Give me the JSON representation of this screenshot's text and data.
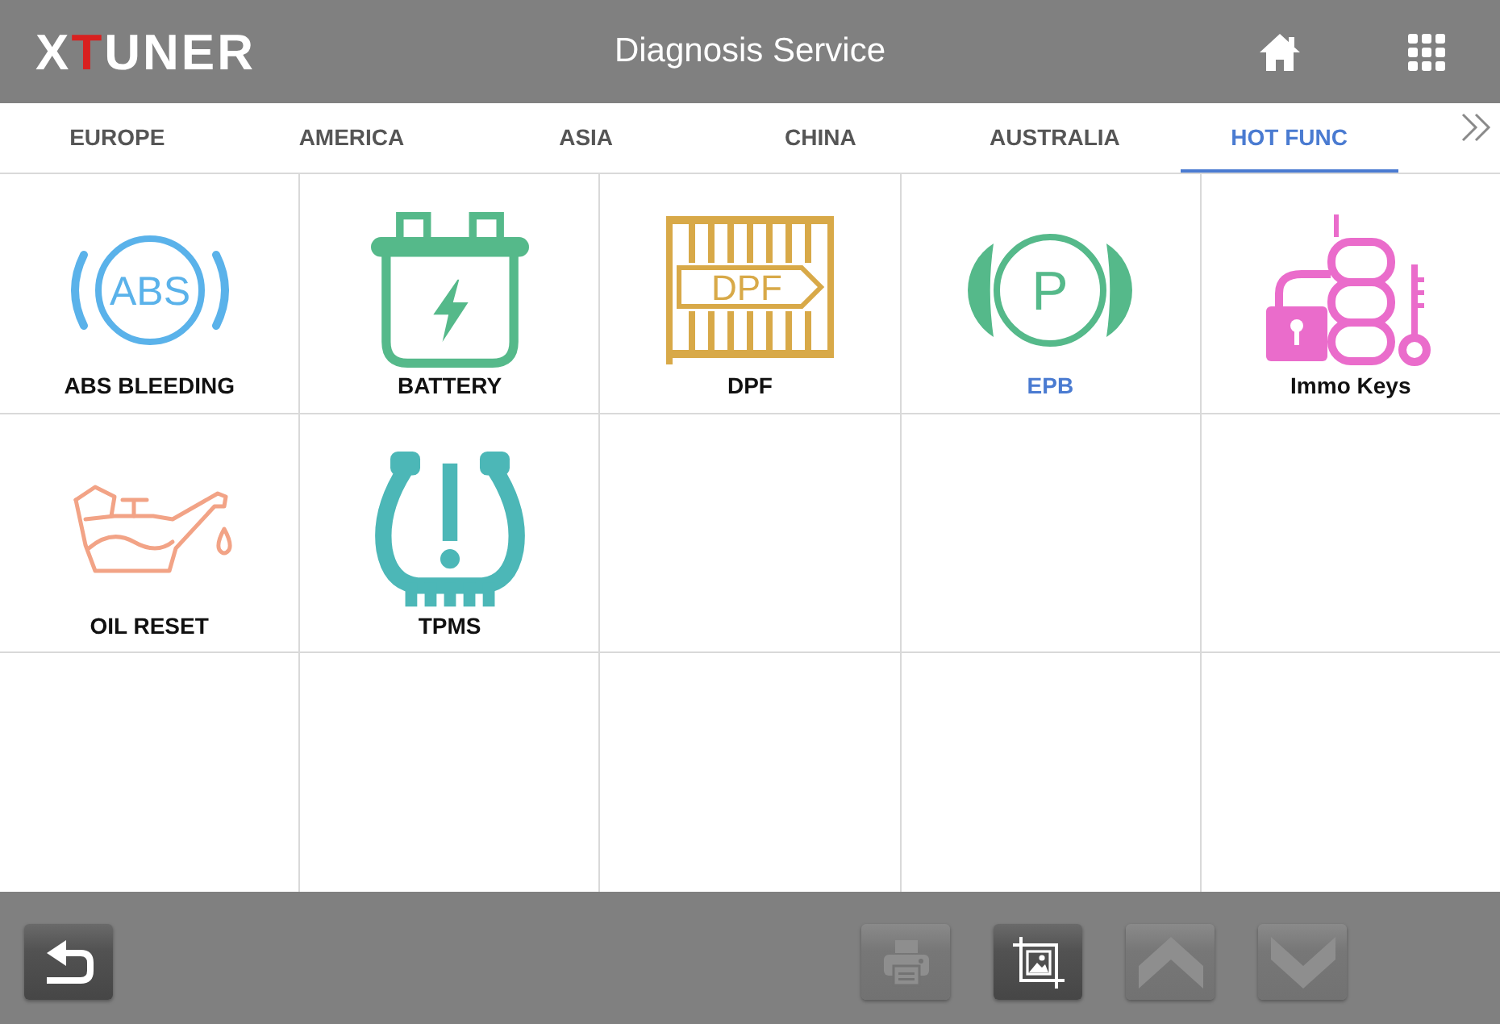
{
  "header": {
    "logo": "XTUNER",
    "title": "Diagnosis Service"
  },
  "tabs": [
    {
      "label": "EUROPE",
      "selected": false
    },
    {
      "label": "AMERICA",
      "selected": false
    },
    {
      "label": "ASIA",
      "selected": false
    },
    {
      "label": "CHINA",
      "selected": false
    },
    {
      "label": "AUSTRALIA",
      "selected": false
    },
    {
      "label": "HOT FUNC",
      "selected": true
    }
  ],
  "functions": [
    {
      "kind": "abs",
      "label": "ABS BLEEDING",
      "icon_text": "ABS",
      "selected": false
    },
    {
      "kind": "battery",
      "label": "BATTERY",
      "selected": false
    },
    {
      "kind": "dpf",
      "label": "DPF",
      "icon_text": "DPF",
      "selected": false
    },
    {
      "kind": "epb",
      "label": "EPB",
      "icon_text": "P",
      "selected": true
    },
    {
      "kind": "immo",
      "label": "Immo Keys",
      "selected": false
    },
    {
      "kind": "oil",
      "label": "OIL RESET",
      "selected": false
    },
    {
      "kind": "tpms",
      "label": "TPMS",
      "selected": false
    }
  ],
  "bottom_bar": {
    "left_buttons": [
      {
        "kind": "back",
        "disabled": false
      }
    ],
    "right_buttons": [
      {
        "kind": "print",
        "disabled": true
      },
      {
        "kind": "screenshot",
        "disabled": false
      },
      {
        "kind": "page_up",
        "disabled": true
      },
      {
        "kind": "page_down",
        "disabled": true
      }
    ]
  }
}
